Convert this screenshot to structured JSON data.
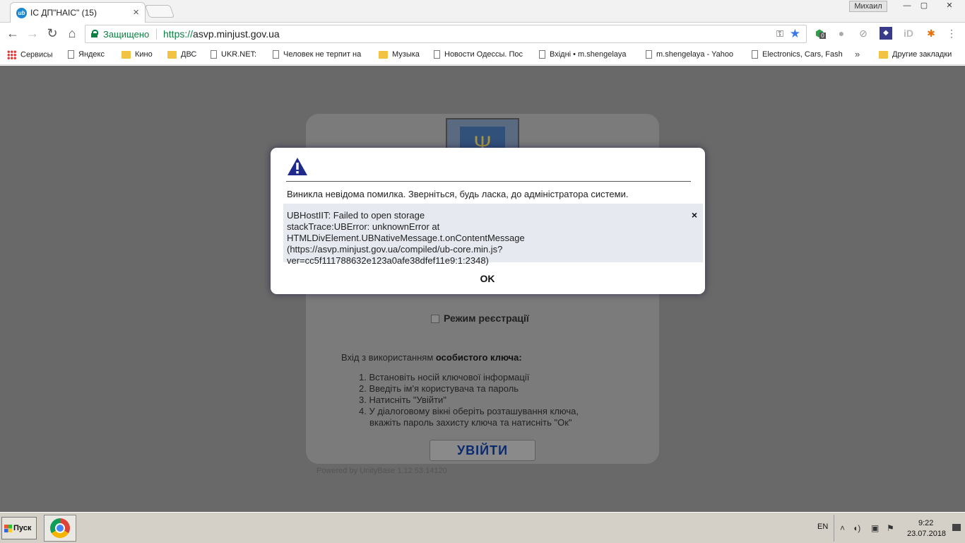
{
  "browser": {
    "tab": {
      "favicon": "ub-favicon-icon",
      "title": "ІС ДП\"НАІС\" (15)"
    },
    "profile_name": "Михаил",
    "window_controls": {
      "minimize": "—",
      "maximize": "▢",
      "close": "✕"
    },
    "address": {
      "secure_label": "Защищено",
      "scheme": "https://",
      "host": "asvp.minjust.gov.ua"
    },
    "bookmarks": [
      {
        "label": "Сервисы",
        "icon": "apps-icon"
      },
      {
        "label": "Яндекс",
        "icon": "page-icon"
      },
      {
        "label": "Кино",
        "icon": "folder-icon"
      },
      {
        "label": "ДВС",
        "icon": "folder-icon"
      },
      {
        "label": "UKR.NET:",
        "icon": "page-icon"
      },
      {
        "label": "Человек не терпит на",
        "icon": "page-icon"
      },
      {
        "label": "Музыка",
        "icon": "folder-icon"
      },
      {
        "label": "Новости Одессы. Пос",
        "icon": "page-icon"
      },
      {
        "label": "Вхідні • m.shengelaya",
        "icon": "page-icon"
      },
      {
        "label": "m.shengelaya - Yahoo",
        "icon": "page-icon"
      },
      {
        "label": "Electronics, Cars, Fash",
        "icon": "page-icon"
      }
    ],
    "bookmarks_more": "»",
    "other_bookmarks": "Другие закладки",
    "extension_badge": "0"
  },
  "login": {
    "registration_mode": "Режим реєстрації",
    "instructions_prefix": "Вхід з використанням ",
    "instructions_bold": "особистого ключа:",
    "steps": [
      "1. Встановіть носій ключової інформації",
      "2. Введіть ім'я користувача та пароль",
      "3. Натисніть \"Увійти\"",
      "4. У діалоговому вікні оберіть розташування ключа,",
      "вкажіть пароль захисту ключа та натисніть \"Ок\""
    ],
    "login_button": "УВІЙТИ",
    "powered_by": "Powered by UnityBase 1.12.53.14120"
  },
  "dialog": {
    "icon": "warning-icon",
    "message": "Виникла невідома помилка. Зверніться, будь ласка, до адміністратора системи.",
    "error_lines": [
      "UBHostIIT: Failed to open storage",
      "stackTrace:UBError: unknownError at HTMLDivElement.UBNativeMessage.t.onContentMessage",
      "(https://asvp.minjust.gov.ua/compiled/ub-core.min.js?",
      "ver=cc5f111788632e123a0afe38dfef11e9:1:2348)"
    ],
    "error_close": "×",
    "ok_label": "OK"
  },
  "taskbar": {
    "start_label": "Пуск",
    "language": "EN",
    "time": "9:22",
    "date": "23.07.2018"
  },
  "colors": {
    "secure_green": "#0b8043",
    "overlay_gray": "#696969",
    "dialog_warning_blue": "#1f2a8c",
    "login_button_text": "#0b2a6b"
  }
}
